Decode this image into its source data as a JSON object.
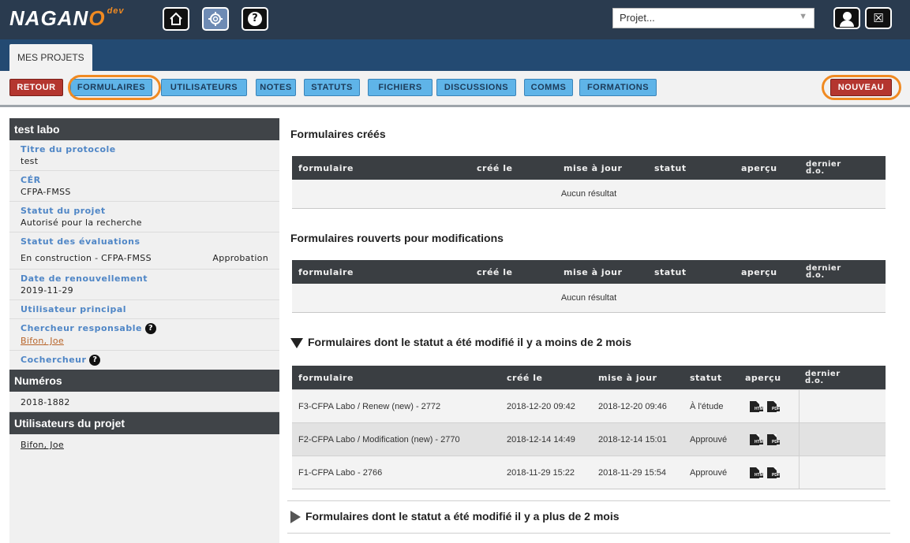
{
  "app": {
    "logo_text": "NAGAN",
    "logo_o": "O",
    "logo_suffix": "dev",
    "nav_icons": [
      "home-icon",
      "gear-icon",
      "help-icon"
    ],
    "help_glyph": "?",
    "project_select": {
      "value": "Projet...",
      "options_visible": [
        "Projet..."
      ]
    },
    "user_icons": [
      "user-icon",
      "logout-icon"
    ],
    "logout_glyph": "☒"
  },
  "tabs": [
    {
      "label": "MES PROJETS"
    }
  ],
  "buttons": {
    "retour": "RETOUR",
    "formulaires": "FORMULAIRES",
    "utilisateurs": "UTILISATEURS",
    "notes": "NOTES",
    "statuts": "STATUTS",
    "fichiers": "FICHIERS",
    "discussions": "DISCUSSIONS",
    "comms": "COMMS",
    "formations": "FORMATIONS",
    "nouveau": "NOUVEAU"
  },
  "sidebar": {
    "project_name": "test labo",
    "fields": {
      "titre_label": "Titre du protocole",
      "titre_value": "test",
      "cer_label": "CÉR",
      "cer_value": "CFPA-FMSS",
      "statut_label": "Statut du projet",
      "statut_value": "Autorisé pour la recherche",
      "eval_label": "Statut des évaluations",
      "eval_value": "En construction - CFPA-FMSS",
      "eval_value2": "Approbation",
      "renew_label": "Date de renouvellement",
      "renew_value": "2019-11-29",
      "user_label": "Utilisateur principal",
      "chercheur_label": "Chercheur responsable",
      "chercheur_value": "Bifon, Joe",
      "cochercheur_label": "Cochercheur",
      "help_glyph": "?"
    },
    "numeros_header": "Numéros",
    "numeros_value": "2018-1882",
    "users_header": "Utilisateurs du projet",
    "users_value": "Bifon, Joe"
  },
  "main": {
    "section1_title": "Formulaires créés",
    "section2_title": "Formulaires rouverts pour modifications",
    "section3_title": "Formulaires dont le statut a été modifié il y a moins de 2 mois",
    "section4_title": "Formulaires dont le statut a été modifié il y a plus de 2 mois",
    "no_result": "Aucun résultat",
    "columns": {
      "formulaire": "formulaire",
      "cree": "créé le",
      "maj": "mise à jour",
      "statut": "statut",
      "apercu": "aperçu",
      "dernier": "dernier",
      "do": "d.o."
    },
    "rows": [
      {
        "formulaire": "F3-CFPA Labo / Renew (new) - 2772",
        "cree": "2018-12-20 09:42",
        "maj": "2018-12-20 09:46",
        "statut": "À l'étude"
      },
      {
        "formulaire": "F2-CFPA Labo / Modification (new) - 2770",
        "cree": "2018-12-14 14:49",
        "maj": "2018-12-14 15:01",
        "statut": "Approuvé"
      },
      {
        "formulaire": "F1-CFPA Labo - 2766",
        "cree": "2018-11-29 15:22",
        "maj": "2018-11-29 15:54",
        "statut": "Approuvé"
      }
    ],
    "doc_labels": {
      "htm": "HTM",
      "pdf": "PDF"
    }
  },
  "colors": {
    "topbar": "#2a3b4f",
    "tabrow": "#234a72",
    "accent_orange": "#f08a22",
    "button_red": "#b4362f",
    "button_blue": "#5fb4e8",
    "sidebar_label": "#4f86c6"
  }
}
